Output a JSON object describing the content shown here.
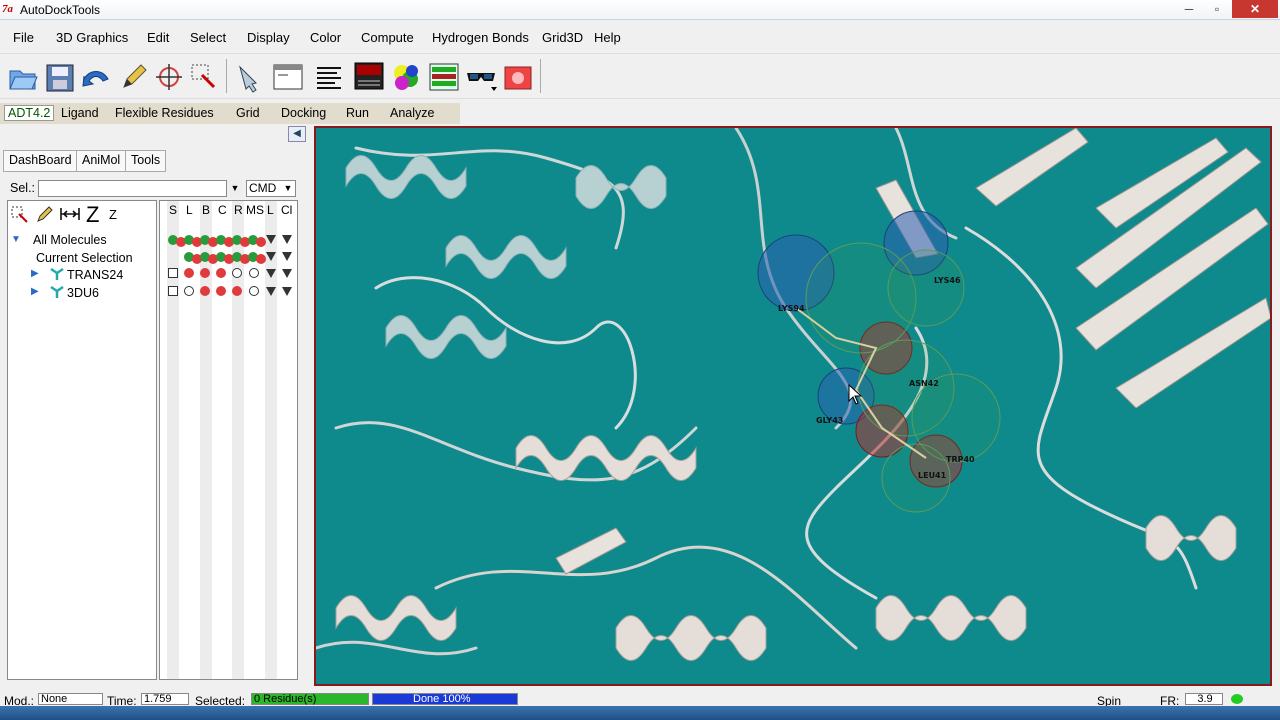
{
  "window": {
    "title": "AutoDockTools",
    "icon_text": "7a",
    "min": "─",
    "max": "▫",
    "close": "✕"
  },
  "menu": {
    "items": [
      "File",
      "3D Graphics",
      "Edit",
      "Select",
      "Display",
      "Color",
      "Compute",
      "Hydrogen Bonds",
      "Grid3D",
      "Help"
    ]
  },
  "toolbar": {
    "icons": [
      "open-file-icon",
      "save-icon",
      "undo-icon",
      "pencil-icon",
      "crosshair-icon",
      "select-icon",
      "pick-icon",
      "python-shell-icon",
      "text-list-icon",
      "log-window-icon",
      "color-spheres-icon",
      "grid-settings-icon",
      "stereo-glasses-icon",
      "camera-icon"
    ]
  },
  "adt_bar": {
    "version": "ADT4.2",
    "items": [
      "Ligand",
      "Flexible Residues",
      "Grid",
      "Docking",
      "Run",
      "Analyze"
    ]
  },
  "left_panel": {
    "collapse_icon": "◀",
    "tabs": [
      "DashBoard",
      "AniMol",
      "Tools"
    ],
    "sel_label": "Sel.:",
    "sel_value": "",
    "dropdown_arrow": "▼",
    "cmd_value": "CMD",
    "tree_toolbar_label": "Z",
    "tree_toolbar_z": "Z",
    "columns": [
      "S",
      "L",
      "B",
      "C",
      "R",
      "MS",
      "L",
      "Cl"
    ],
    "tree": {
      "root": "All Molecules",
      "current_selection": "Current Selection",
      "molecules": [
        "TRANS24",
        "3DU6"
      ]
    }
  },
  "viewer": {
    "background": "#0e8a8c",
    "residue_labels": [
      "LYS46",
      "LYS94",
      "ASN42",
      "GLY43",
      "LEU41",
      "TRP40"
    ]
  },
  "statusbar": {
    "mod_label": "Mod.:",
    "mod_value": "None",
    "time_label": "Time:",
    "time_value": "1.759",
    "selected_label": "Selected:",
    "selected_value": "0 Residue(s)",
    "progress_text": "Done 100%",
    "progress": 1.0,
    "spin_label": "Spin",
    "fr_label": "FR:",
    "fr_value": "3.9"
  }
}
